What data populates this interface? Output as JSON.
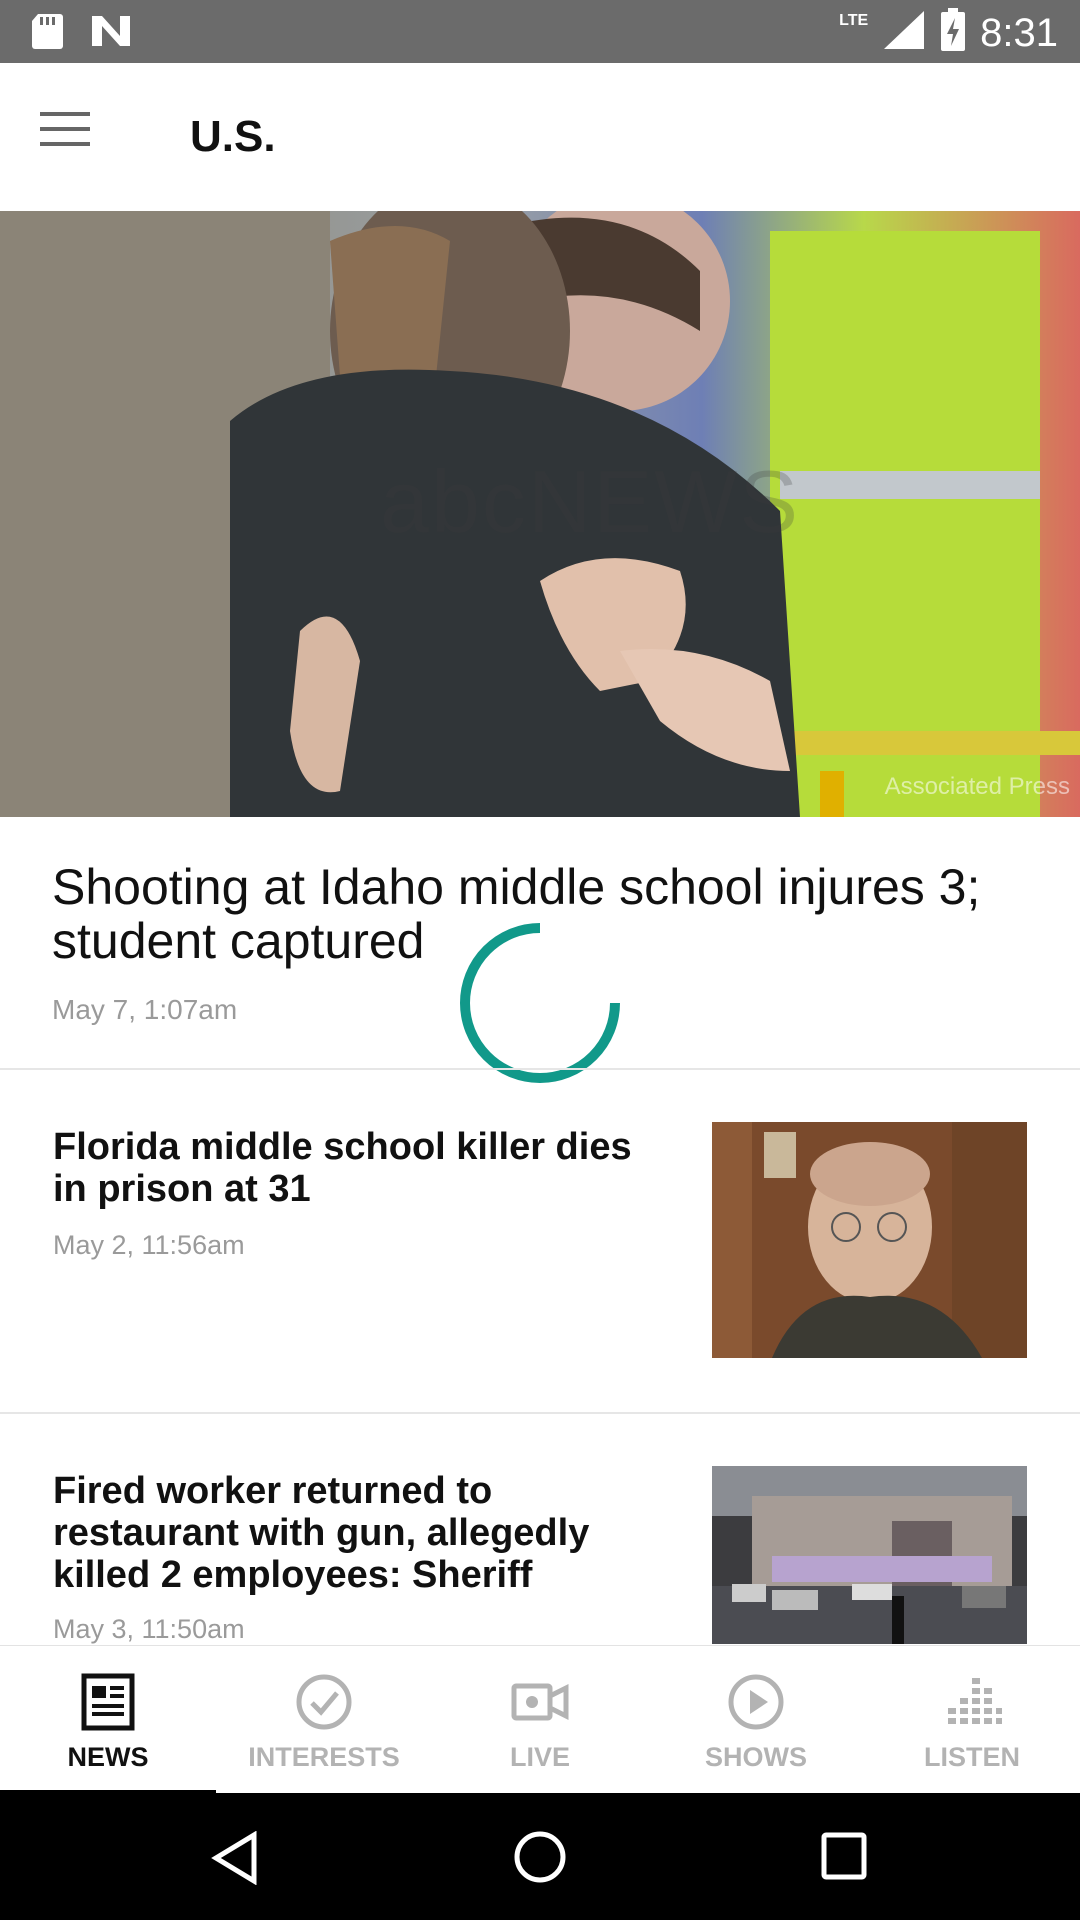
{
  "status_bar": {
    "time": "8:31",
    "network": "LTE",
    "icons": [
      "sd-card-icon",
      "n-logo-icon",
      "signal-icon",
      "battery-charging-icon"
    ]
  },
  "header": {
    "title": "U.S.",
    "menu_icon": "hamburger-menu-icon"
  },
  "hero": {
    "headline": "Shooting at Idaho middle school injures 3; student captured",
    "date": "May 7, 1:07am",
    "photo_credit": "Associated Press",
    "watermark": "abcNEWS"
  },
  "articles": [
    {
      "headline": "Florida middle school killer dies in prison at 31",
      "date": "May 2, 11:56am"
    },
    {
      "headline": "Fired worker returned to restaurant with gun, allegedly killed 2 employees: Sheriff",
      "date": "May 3, 11:50am"
    }
  ],
  "bottom_nav": {
    "items": [
      {
        "label": "NEWS",
        "icon": "newspaper-icon",
        "active": true
      },
      {
        "label": "INTERESTS",
        "icon": "check-circle-icon",
        "active": false
      },
      {
        "label": "LIVE",
        "icon": "video-camera-icon",
        "active": false
      },
      {
        "label": "SHOWS",
        "icon": "play-circle-icon",
        "active": false
      },
      {
        "label": "LISTEN",
        "icon": "equalizer-icon",
        "active": false
      }
    ]
  },
  "system_nav": {
    "icons": [
      "back-icon",
      "home-icon",
      "recents-icon"
    ]
  },
  "colors": {
    "spinner": "#11998a",
    "status_bar": "#6b6b6b",
    "inactive_nav": "#b3b3b3"
  }
}
